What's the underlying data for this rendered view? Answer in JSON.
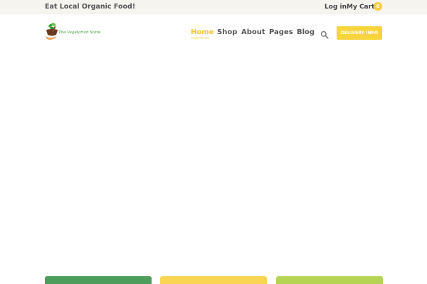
{
  "topbar": {
    "tagline": "Eat Local Organic Food!",
    "login_label": "Log in",
    "cart_label": "My Cart",
    "cart_count": "0",
    "cart_badge_color": "#f7cc3b"
  },
  "header": {
    "logo_text": "The Vegetarian Store",
    "nav": [
      {
        "label": "Home",
        "active": true
      },
      {
        "label": "Shop",
        "active": false
      },
      {
        "label": "About",
        "active": false
      },
      {
        "label": "Pages",
        "active": false
      },
      {
        "label": "Blog",
        "active": false
      }
    ],
    "search_icon": "search-icon",
    "delivery_label": "DELIVERY INFO",
    "accent_color": "#f4c53a"
  },
  "features": {
    "colors": [
      "#4e9d5c",
      "#f9d553",
      "#b6d453"
    ]
  }
}
